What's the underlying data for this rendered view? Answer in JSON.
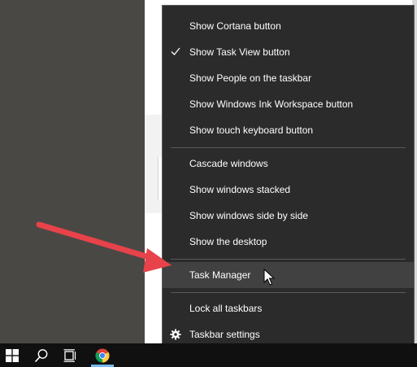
{
  "menu": {
    "items": [
      {
        "label": "Show Cortana button"
      },
      {
        "label": "Show Task View button",
        "checked": true
      },
      {
        "label": "Show People on the taskbar"
      },
      {
        "label": "Show Windows Ink Workspace button"
      },
      {
        "label": "Show touch keyboard button"
      },
      {
        "label": "Cascade windows"
      },
      {
        "label": "Show windows stacked"
      },
      {
        "label": "Show windows side by side"
      },
      {
        "label": "Show the desktop"
      },
      {
        "label": "Task Manager",
        "hovered": true
      },
      {
        "label": "Lock all taskbars"
      },
      {
        "label": "Taskbar settings",
        "icon": "gear-icon"
      }
    ]
  },
  "taskbar": {
    "icons": [
      "windows-start-icon",
      "search-icon",
      "task-view-icon",
      "chrome-icon"
    ]
  },
  "colors": {
    "menu_bg": "#2b2b2b",
    "hover_bg": "#414141",
    "arrow": "#e8424a",
    "taskbar_bg": "#101010"
  }
}
